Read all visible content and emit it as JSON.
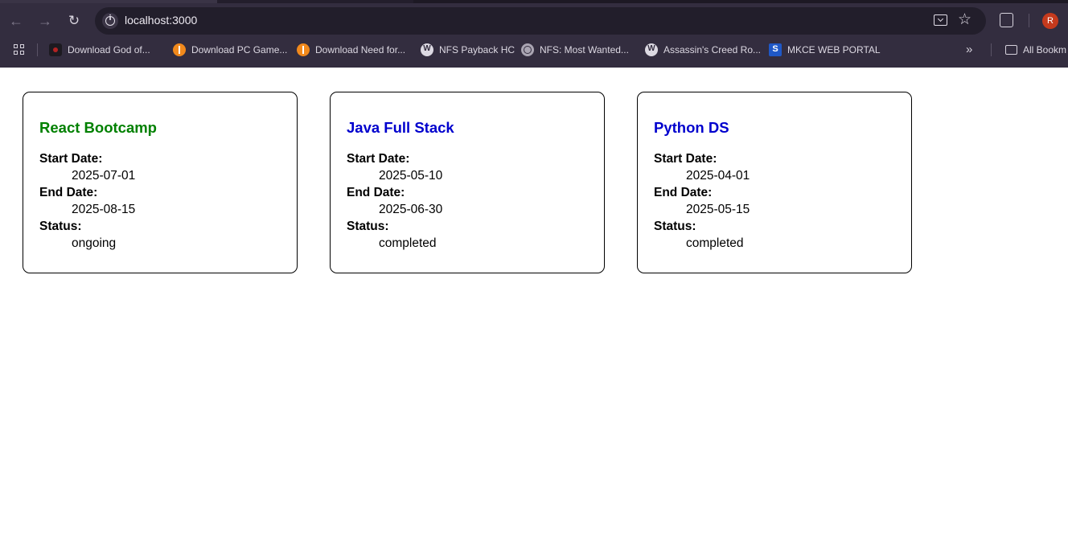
{
  "browser": {
    "url": "localhost:3000",
    "profile_initial": "R",
    "bookmarks": [
      {
        "label": "Download God of...",
        "icon": "god-of-war-icon"
      },
      {
        "label": "Download PC Game...",
        "icon": "orange-info-icon"
      },
      {
        "label": "Download Need for...",
        "icon": "orange-info-icon"
      },
      {
        "label": "NFS Payback HC",
        "icon": "wordpress-icon"
      },
      {
        "label": "NFS: Most Wanted...",
        "icon": "globe-icon"
      },
      {
        "label": "Assassin's Creed Ro...",
        "icon": "wordpress-icon"
      },
      {
        "label": "MKCE WEB PORTAL",
        "icon": "mkce-icon"
      }
    ],
    "all_bookmarks_label": "All Bookm"
  },
  "cards": [
    {
      "title": "React Bootcamp",
      "title_color": "#008000",
      "start_label": "Start Date:",
      "start_date": "2025-07-01",
      "end_label": "End Date:",
      "end_date": "2025-08-15",
      "status_label": "Status:",
      "status": "ongoing"
    },
    {
      "title": "Java Full Stack",
      "title_color": "#0000cd",
      "start_label": "Start Date:",
      "start_date": "2025-05-10",
      "end_label": "End Date:",
      "end_date": "2025-06-30",
      "status_label": "Status:",
      "status": "completed"
    },
    {
      "title": "Python DS",
      "title_color": "#0000cd",
      "start_label": "Start Date:",
      "start_date": "2025-04-01",
      "end_label": "End Date:",
      "end_date": "2025-05-15",
      "status_label": "Status:",
      "status": "completed"
    }
  ]
}
